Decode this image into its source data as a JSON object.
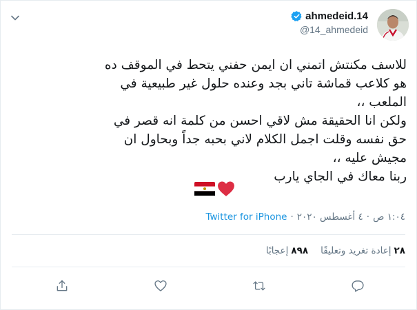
{
  "header": {
    "display_name": "ahmedeid.14",
    "handle": "@14_ahmedeid"
  },
  "tweet": {
    "text": "للاسف مكنتش اتمني ان ايمن حفني يتحط في الموقف ده\nهو كلاعب قماشة تاني بجد وعنده حلول غير طبيعية في\nالملعب ،،\nولكن انا الحقيقة مش لاقي احسن من كلمة انه قصر في\nحق نفسه وقلت اجمل الكلام لاني بحبه جداً وبحاول ان\nمجيش عليه ،،\nربنا معاك في الجاي يارب",
    "emojis": [
      "red-heart-icon",
      "egypt-flag-icon"
    ]
  },
  "meta": {
    "time": "١:٠٤ ص",
    "separator": "·",
    "date": "٤ أغسطس ٢٠٢٠",
    "source": "Twitter for iPhone"
  },
  "stats": {
    "retweets_count": "٢٨",
    "retweets_label": "إعادة تغريد وتعليقًا",
    "likes_count": "٨٩٨",
    "likes_label": "إعجابًا"
  },
  "colors": {
    "link": "#1b95e0",
    "muted": "#657786",
    "verified": "#1da1f2",
    "heart": "#e0245e",
    "flag_red": "#ce1126",
    "flag_black": "#000000"
  }
}
